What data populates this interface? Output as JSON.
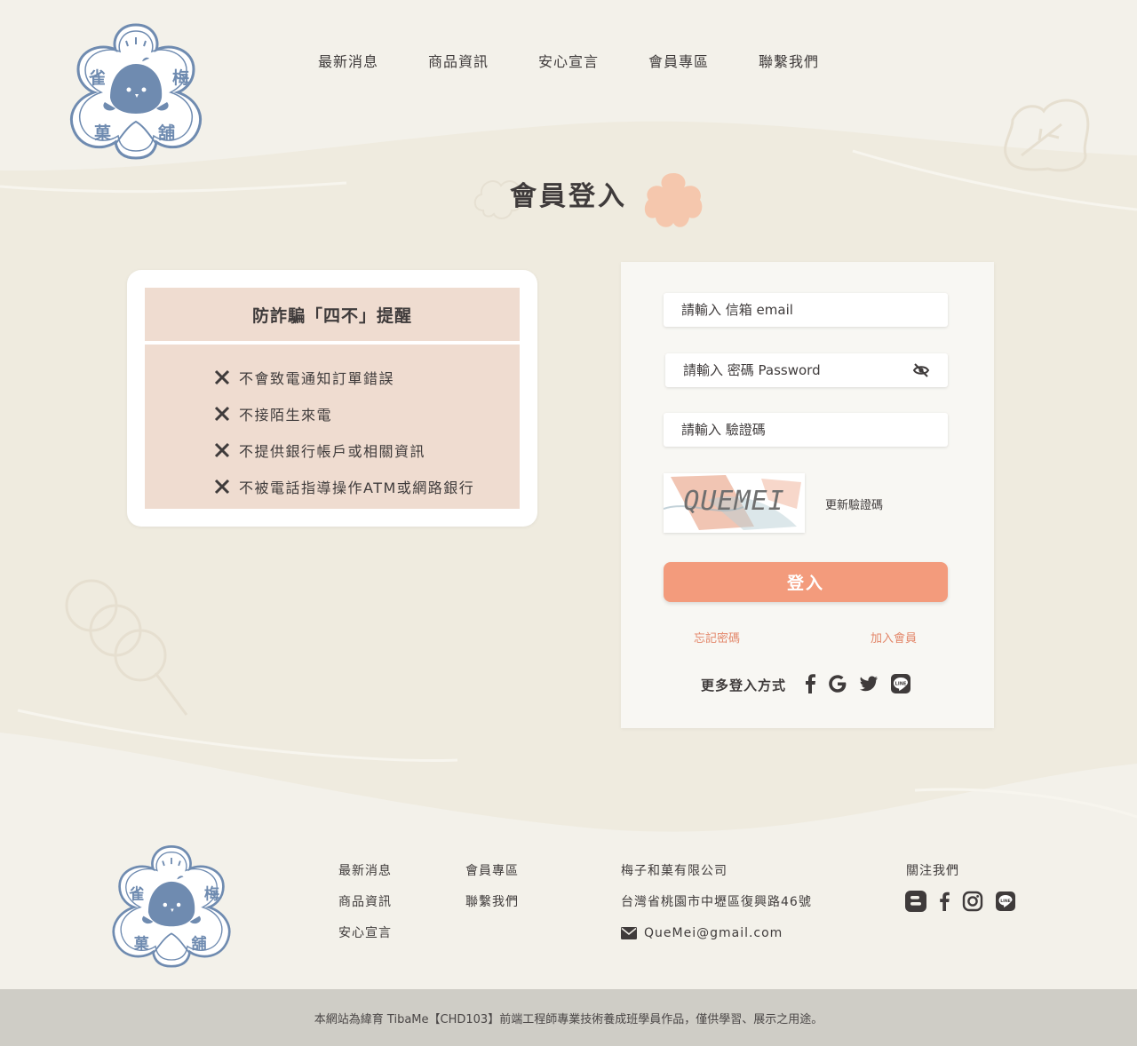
{
  "brand": {
    "logo_chars": [
      "雀",
      "梅",
      "菓",
      "舖"
    ],
    "color_primary": "#6f8bb0",
    "color_accent": "#f39b7c"
  },
  "nav": {
    "items": [
      {
        "label": "最新消息"
      },
      {
        "label": "商品資訊"
      },
      {
        "label": "安心宣言"
      },
      {
        "label": "會員專區"
      },
      {
        "label": "聯繫我們"
      }
    ]
  },
  "page": {
    "title": "會員登入"
  },
  "reminder": {
    "heading": "防詐騙「四不」提醒",
    "items": [
      "不會致電通知訂單錯誤",
      "不接陌生來電",
      "不提供銀行帳戶或相關資訊",
      "不被電話指導操作ATM或網路銀行"
    ]
  },
  "login": {
    "email_placeholder": "請輸入 信箱 email",
    "password_placeholder": "請輸入 密碼 Password",
    "captcha_placeholder": "請輸入 驗證碼",
    "captcha_text": "QUEMEI",
    "refresh_label": "更新驗證碼",
    "submit_label": "登入",
    "forgot_label": "忘記密碼",
    "join_label": "加入會員",
    "more_label": "更多登入方式",
    "social_icons": [
      "facebook-icon",
      "google-icon",
      "twitter-icon",
      "line-icon"
    ]
  },
  "footer": {
    "col1": [
      "最新消息",
      "商品資訊",
      "安心宣言"
    ],
    "col2": [
      "會員專區",
      "聯繫我們"
    ],
    "company": "梅子和菓有限公司",
    "address": "台灣省桃園市中壢區復興路46號",
    "email": "QueMei@gmail.com",
    "follow_label": "關注我們",
    "social_icons": [
      "blogger-icon",
      "facebook-icon",
      "instagram-icon",
      "line-icon"
    ],
    "copyright": "本網站為緯育 TibaMe【CHD103】前端工程師專業技術養成班學員作品，僅供學習、展示之用途。"
  }
}
